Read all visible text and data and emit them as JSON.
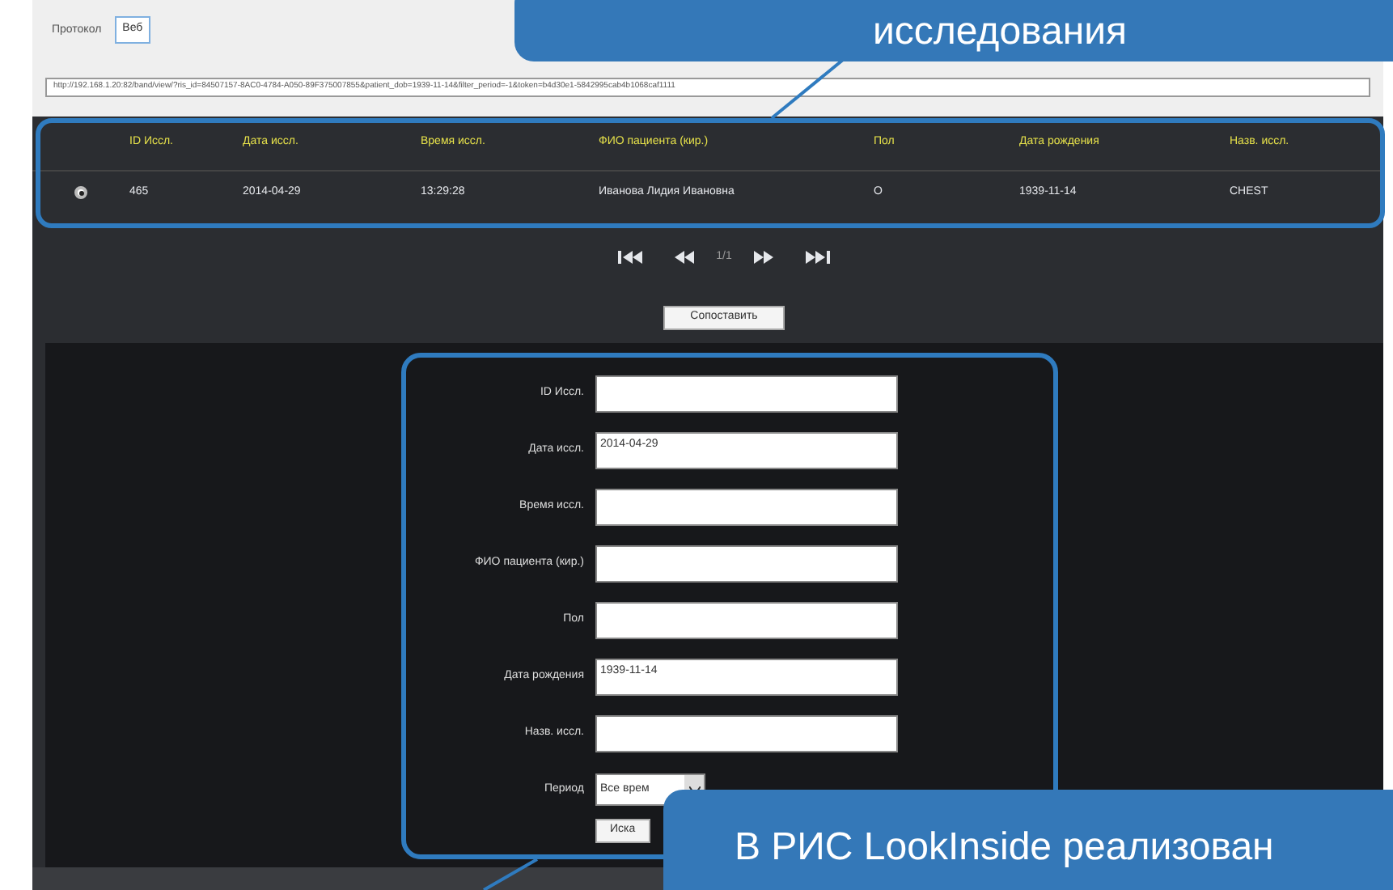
{
  "tabs": [
    {
      "label": "Протокол",
      "selected": false
    },
    {
      "label": "Веб",
      "selected": true
    }
  ],
  "address_bar": {
    "value": "http://192.168.1.20:82/band/view/?ris_id=84507157-8AC0-4784-A050-89F375007855&patient_dob=1939-11-14&filter_period=-1&token=b4d30e1-5842995cab4b1068caf1111"
  },
  "results_table": {
    "columns": [
      "ID Иссл.",
      "Дата иссл.",
      "Время иссл.",
      "ФИО пациента (кир.)",
      "Пол",
      "Дата рождения",
      "Назв. иссл."
    ],
    "rows": [
      {
        "selected": true,
        "cells": [
          "465",
          "2014-04-29",
          "13:29:28",
          "Иванова Лидия Ивановна",
          "O",
          "1939-11-14",
          "CHEST"
        ]
      }
    ]
  },
  "pager": {
    "page": "1/1"
  },
  "match_button": "Сопоставить",
  "search_form": {
    "fields": [
      {
        "kind": "text",
        "label": "ID Иссл."
      },
      {
        "kind": "text",
        "label": "Дата иссл.",
        "value": "2014-04-29"
      },
      {
        "kind": "text",
        "label": "Время иссл."
      },
      {
        "kind": "text",
        "label": "ФИО пациента (кир.)"
      },
      {
        "kind": "text",
        "label": "Пол"
      },
      {
        "kind": "text",
        "label": "Дата рождения",
        "value": "1939-11-14"
      },
      {
        "kind": "text",
        "label": "Назв. иссл."
      },
      {
        "kind": "select",
        "label": "Период",
        "value": "Все врем"
      }
    ],
    "search_button": "Иска"
  },
  "callouts": [
    {
      "text": "исследования"
    },
    {
      "text": "В РИС LookInside реализован"
    }
  ]
}
